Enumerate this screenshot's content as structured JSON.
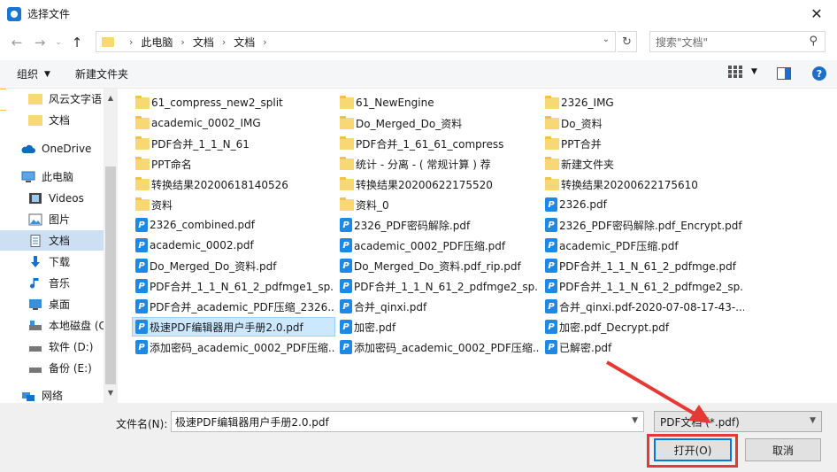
{
  "window": {
    "title": "选择文件",
    "close_glyph": "✕"
  },
  "nav": {
    "breadcrumbs": [
      "此电脑",
      "文档",
      "文档"
    ],
    "search_placeholder": "搜索\"文档\""
  },
  "toolbar": {
    "organize": "组织",
    "new_folder": "新建文件夹"
  },
  "sidebar": {
    "items": [
      {
        "label": "风云文字语",
        "icon": "folder-icon"
      },
      {
        "label": "文档",
        "icon": "folder-icon"
      },
      {
        "label": "OneDrive",
        "icon": "cloud-icon"
      },
      {
        "label": "此电脑",
        "icon": "computer-icon"
      },
      {
        "label": "Videos",
        "icon": "video-icon"
      },
      {
        "label": "图片",
        "icon": "pictures-icon"
      },
      {
        "label": "文档",
        "icon": "documents-icon"
      },
      {
        "label": "下载",
        "icon": "download-icon"
      },
      {
        "label": "音乐",
        "icon": "music-icon"
      },
      {
        "label": "桌面",
        "icon": "desktop-icon"
      },
      {
        "label": "本地磁盘 (C",
        "icon": "drive-icon"
      },
      {
        "label": "软件 (D:)",
        "icon": "drive-icon"
      },
      {
        "label": "备份 (E:)",
        "icon": "drive-icon"
      },
      {
        "label": "网络",
        "icon": "network-icon"
      }
    ]
  },
  "files": {
    "col1": [
      {
        "name": "61_compress_new2_split",
        "type": "folder"
      },
      {
        "name": "academic_0002_IMG",
        "type": "folder"
      },
      {
        "name": "PDF合并_1_1_N_61",
        "type": "folder"
      },
      {
        "name": "PPT命名",
        "type": "folder"
      },
      {
        "name": "转换结果20200618140526",
        "type": "folder"
      },
      {
        "name": "资料",
        "type": "folder"
      },
      {
        "name": "2326_combined.pdf",
        "type": "pdf"
      },
      {
        "name": "academic_0002.pdf",
        "type": "pdf"
      },
      {
        "name": "Do_Merged_Do_资料.pdf",
        "type": "pdf"
      },
      {
        "name": "PDF合并_1_1_N_61_2_pdfmge1_sp...",
        "type": "pdf"
      },
      {
        "name": "PDF合并_academic_PDF压缩_2326....",
        "type": "pdf"
      },
      {
        "name": "极速PDF编辑器用户手册2.0.pdf",
        "type": "pdf",
        "selected": true
      },
      {
        "name": "添加密码_academic_0002_PDF压缩...",
        "type": "pdf"
      }
    ],
    "col2": [
      {
        "name": "61_NewEngine",
        "type": "folder"
      },
      {
        "name": "Do_Merged_Do_资料",
        "type": "folder"
      },
      {
        "name": "PDF合并_1_61_61_compress",
        "type": "folder"
      },
      {
        "name": "统计 - 分离 - ( 常规计算 ) 荐",
        "type": "folder"
      },
      {
        "name": "转换结果20200622175520",
        "type": "folder"
      },
      {
        "name": "资料_0",
        "type": "folder"
      },
      {
        "name": "2326_PDF密码解除.pdf",
        "type": "pdf"
      },
      {
        "name": "academic_0002_PDF压缩.pdf",
        "type": "pdf"
      },
      {
        "name": "Do_Merged_Do_资料.pdf_rip.pdf",
        "type": "pdf"
      },
      {
        "name": "PDF合并_1_1_N_61_2_pdfmge2_sp...",
        "type": "pdf"
      },
      {
        "name": "合并_qinxi.pdf",
        "type": "pdf"
      },
      {
        "name": "加密.pdf",
        "type": "pdf"
      },
      {
        "name": "添加密码_academic_0002_PDF压缩...",
        "type": "pdf"
      }
    ],
    "col3": [
      {
        "name": "2326_IMG",
        "type": "folder"
      },
      {
        "name": "Do_资料",
        "type": "folder"
      },
      {
        "name": "PPT合并",
        "type": "folder"
      },
      {
        "name": "新建文件夹",
        "type": "folder"
      },
      {
        "name": "转换结果20200622175610",
        "type": "folder"
      },
      {
        "name": "2326.pdf",
        "type": "pdf"
      },
      {
        "name": "2326_PDF密码解除.pdf_Encrypt.pdf",
        "type": "pdf"
      },
      {
        "name": "academic_PDF压缩.pdf",
        "type": "pdf"
      },
      {
        "name": "PDF合并_1_1_N_61_2_pdfmge.pdf",
        "type": "pdf"
      },
      {
        "name": "PDF合并_1_1_N_61_2_pdfmge2_sp...",
        "type": "pdf"
      },
      {
        "name": "合并_qinxi.pdf-2020-07-08-17-43-...",
        "type": "pdf"
      },
      {
        "name": "加密.pdf_Decrypt.pdf",
        "type": "pdf"
      },
      {
        "name": "已解密.pdf",
        "type": "pdf"
      }
    ]
  },
  "bottom": {
    "filename_label": "文件名(N):",
    "filename_value": "极速PDF编辑器用户手册2.0.pdf",
    "filetype_value": "PDF文档 (*.pdf)",
    "open_label": "打开(O)",
    "cancel_label": "取消"
  },
  "colors": {
    "annotation": "#e53935",
    "accent": "#0078d7"
  }
}
